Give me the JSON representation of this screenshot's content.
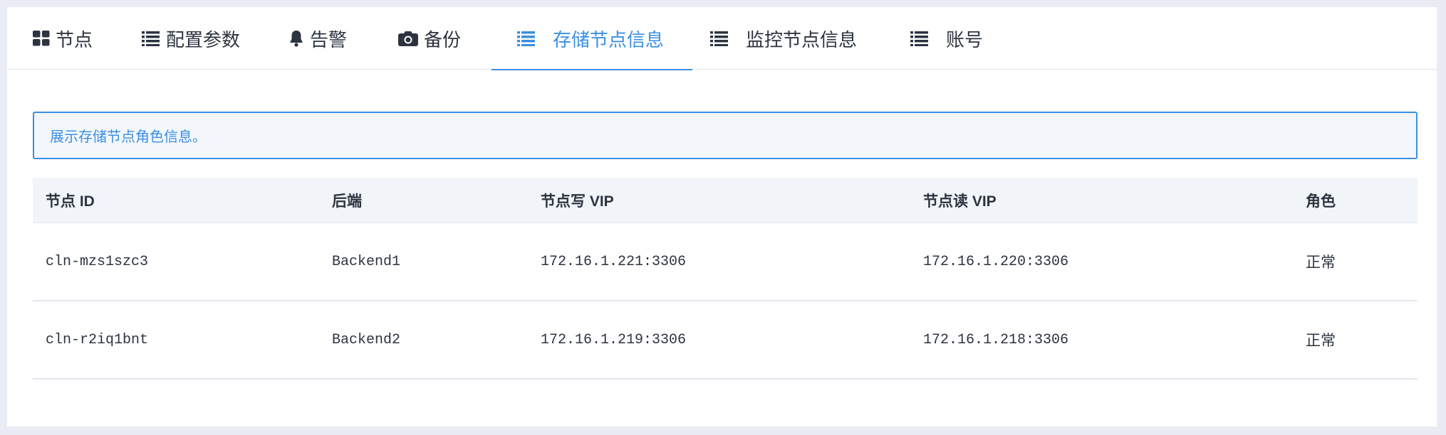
{
  "tabs": [
    {
      "label": "节点",
      "icon": "grid-icon",
      "active": false
    },
    {
      "label": "配置参数",
      "icon": "list-icon",
      "active": false
    },
    {
      "label": "告警",
      "icon": "bell-icon",
      "active": false
    },
    {
      "label": "备份",
      "icon": "camera-icon",
      "active": false
    },
    {
      "label": "存储节点信息",
      "icon": "list-icon",
      "active": true
    },
    {
      "label": "监控节点信息",
      "icon": "list-icon",
      "active": false
    },
    {
      "label": "账号",
      "icon": "list-icon",
      "active": false
    }
  ],
  "colors": {
    "accent": "#3b8fe3",
    "info_bg": "#f3f7fc",
    "header_bg": "#f1f4f8"
  },
  "info": {
    "text": "展示存储节点角色信息。"
  },
  "table": {
    "headers": [
      "节点 ID",
      "后端",
      "节点写 VIP",
      "节点读 VIP",
      "角色"
    ],
    "rows": [
      [
        "cln-mzs1szc3",
        "Backend1",
        "172.16.1.221:3306",
        "172.16.1.220:3306",
        "正常"
      ],
      [
        "cln-r2iq1bnt",
        "Backend2",
        "172.16.1.219:3306",
        "172.16.1.218:3306",
        "正常"
      ]
    ]
  }
}
